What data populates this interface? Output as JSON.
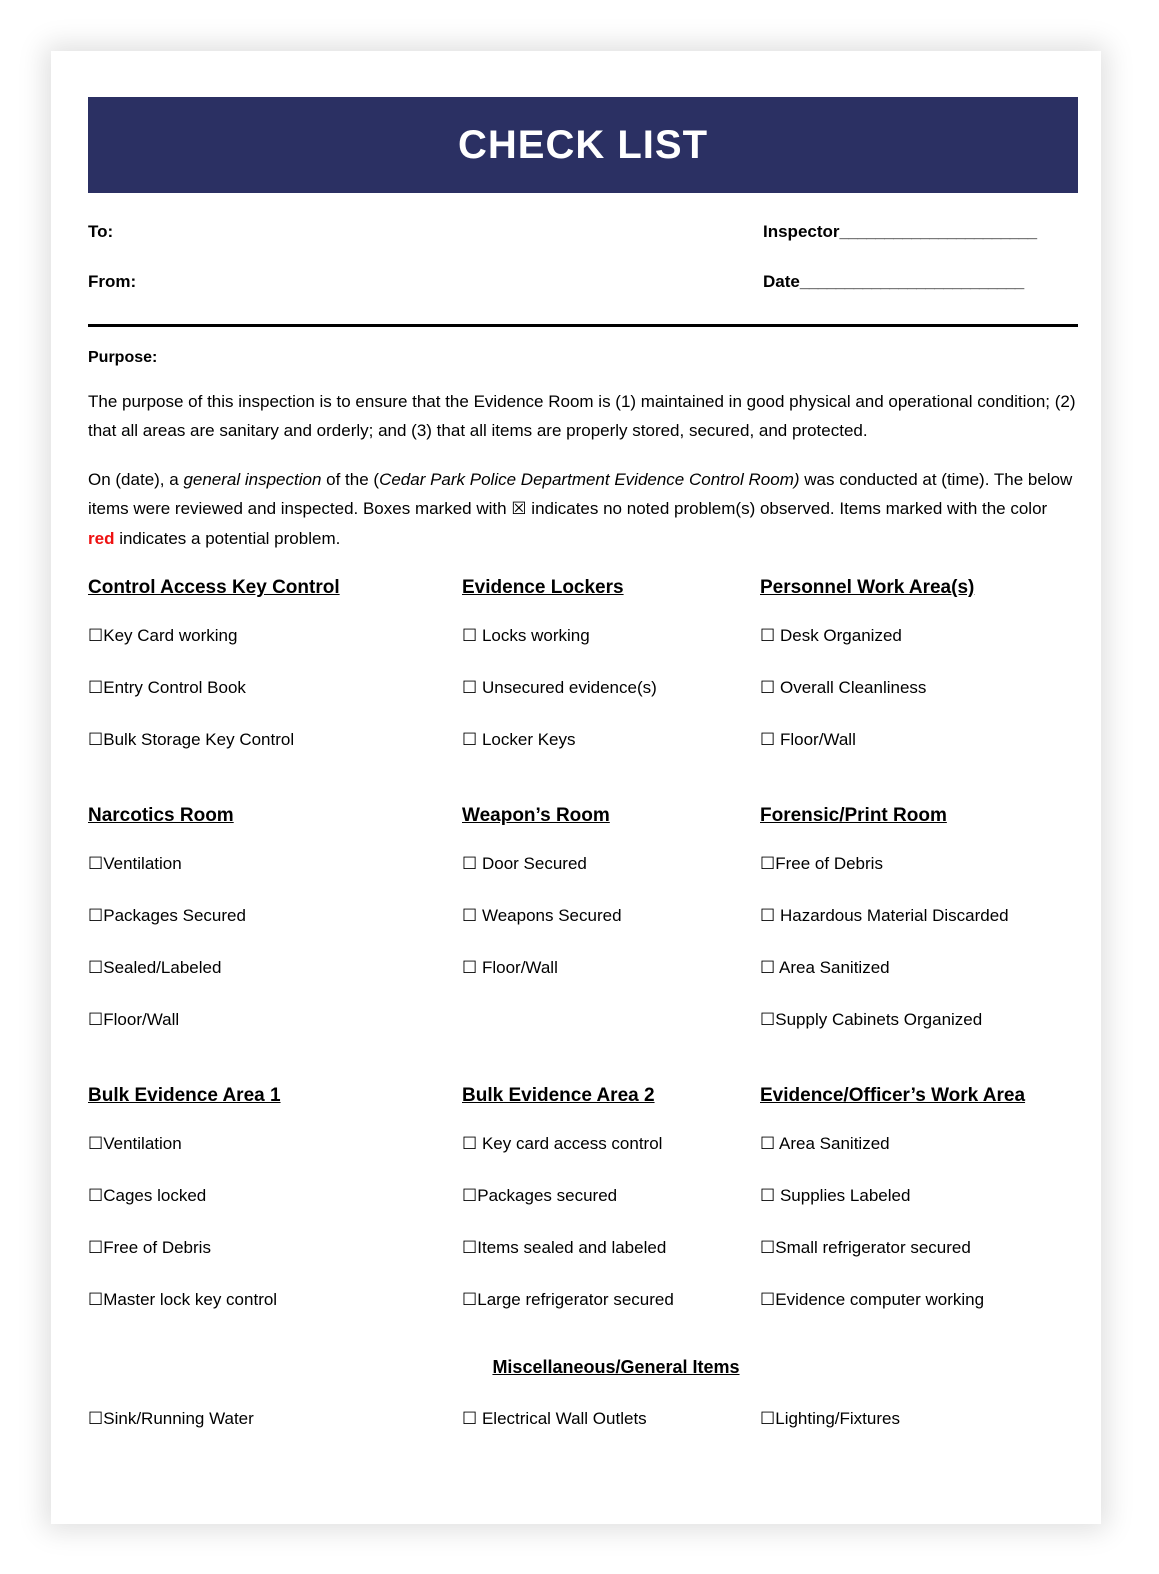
{
  "title": "CHECK LIST",
  "meta": {
    "to_label": "To:",
    "from_label": "From:",
    "inspector_label": "Inspector",
    "inspector_rule": "______________________",
    "date_label": "Date",
    "date_rule": "_________________________"
  },
  "purpose": {
    "heading": "Purpose:",
    "paragraph1": "The purpose of this inspection is to ensure that the Evidence Room is (1) maintained in good physical and operational condition; (2) that all areas are sanitary and orderly; and (3) that all items are properly stored, secured, and protected.",
    "p2_part1": "On (date), a ",
    "p2_italic1": "general inspection",
    "p2_part2": " of the (",
    "p2_italic2": "Cedar Park Police Department Evidence Control Room)",
    "p2_part3": " was conducted at (time).  The below items were reviewed and inspected. Boxes marked with ",
    "p2_checkglyph": "☒",
    "p2_part4": " indicates no noted problem(s) observed.  Items marked with the color ",
    "p2_red": "red",
    "p2_part5": " indicates a potential problem."
  },
  "colors": {
    "banner": "#2b3063",
    "red": "#ee1111",
    "text": "#000000"
  },
  "checkbox_glyph": "☐",
  "sections": [
    {
      "heading": "Control Access Key Control",
      "items": [
        "Key Card working",
        "Entry Control Book",
        "Bulk Storage Key Control"
      ],
      "gaps": [
        "",
        "",
        ""
      ]
    },
    {
      "heading": "Evidence Lockers",
      "items": [
        "Locks working",
        "Unsecured evidence(s)",
        "Locker Keys"
      ],
      "gaps": [
        " ",
        " ",
        " "
      ]
    },
    {
      "heading": "Personnel Work Area(s)",
      "items": [
        "Desk Organized",
        "Overall Cleanliness",
        "Floor/Wall"
      ],
      "gaps": [
        " ",
        " ",
        " "
      ]
    },
    {
      "heading": "Narcotics Room",
      "items": [
        "Ventilation",
        "Packages Secured",
        "Sealed/Labeled",
        "Floor/Wall"
      ],
      "gaps": [
        "",
        "",
        "",
        ""
      ]
    },
    {
      "heading": "Weapon’s Room",
      "items": [
        "Door Secured",
        "Weapons Secured",
        "Floor/Wall"
      ],
      "gaps": [
        " ",
        " ",
        " "
      ]
    },
    {
      "heading": "Forensic/Print Room",
      "items": [
        "Free of Debris",
        "Hazardous Material Discarded",
        "Area Sanitized",
        "Supply Cabinets Organized"
      ],
      "gaps": [
        "",
        " ",
        " ",
        ""
      ]
    },
    {
      "heading": "Bulk Evidence Area 1",
      "items": [
        "Ventilation",
        "Cages locked",
        "Free of Debris",
        "Master lock key control"
      ],
      "gaps": [
        "",
        "",
        "",
        ""
      ]
    },
    {
      "heading": "Bulk Evidence Area 2",
      "items": [
        "Key card access control",
        "Packages secured",
        "Items sealed and labeled",
        "Large refrigerator secured"
      ],
      "gaps": [
        " ",
        "",
        "",
        ""
      ]
    },
    {
      "heading": "Evidence/Officer’s Work Area",
      "items": [
        "Area Sanitized",
        "Supplies Labeled",
        "Small refrigerator secured",
        "Evidence computer working"
      ],
      "gaps": [
        " ",
        " ",
        "",
        ""
      ]
    }
  ],
  "misc": {
    "heading": "Miscellaneous/General Items",
    "items": [
      "Sink/Running Water",
      " Electrical Wall Outlets",
      "Lighting/Fixtures"
    ]
  }
}
